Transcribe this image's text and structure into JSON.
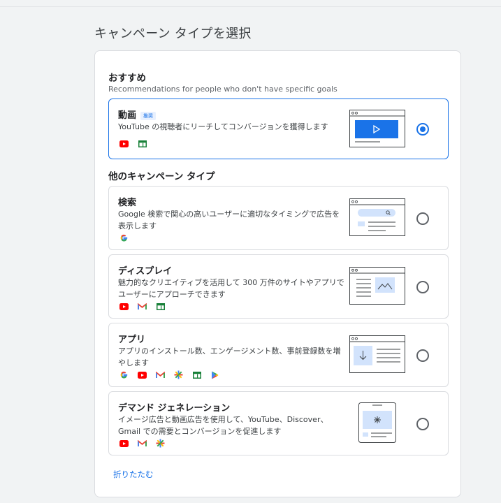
{
  "page": {
    "title": "キャンペーン タイプを選択"
  },
  "recommended": {
    "heading": "おすすめ",
    "subheading": "Recommendations for people who don't have specific goals"
  },
  "others": {
    "heading": "他のキャンペーン タイプ"
  },
  "cards": [
    {
      "title": "動画",
      "badge": "推奨",
      "description": "YouTube の視聴者にリーチしてコンバージョンを獲得します",
      "selected": true,
      "icons": [
        "youtube-icon",
        "display-icon"
      ]
    },
    {
      "title": "検索",
      "description": "Google 検索で関心の高いユーザーに適切なタイミングで広告を表示します",
      "selected": false,
      "icons": [
        "google-icon"
      ]
    },
    {
      "title": "ディスプレイ",
      "description": "魅力的なクリエイティブを活用して 300 万件のサイトやアプリでユーザーにアプローチできます",
      "selected": false,
      "icons": [
        "youtube-icon",
        "gmail-icon",
        "display-icon"
      ]
    },
    {
      "title": "アプリ",
      "description": "アプリのインストール数、エンゲージメント数、事前登録数を増やします",
      "selected": false,
      "icons": [
        "google-icon",
        "youtube-icon",
        "gmail-icon",
        "discover-icon",
        "display-icon",
        "google-play-icon"
      ]
    },
    {
      "title": "デマンド ジェネレーション",
      "description": "イメージ広告と動画広告を使用して、YouTube、Discover、Gmail での需要とコンバージョンを促進します",
      "selected": false,
      "icons": [
        "youtube-icon",
        "gmail-icon",
        "discover-icon"
      ]
    }
  ],
  "collapse": {
    "label": "折りたたむ"
  },
  "colors": {
    "accent": "#1a73e8",
    "youtube": "#ff0000",
    "display_green": "#188038",
    "illus_blue": "#1a73e8",
    "illus_light": "#d2e3fc"
  }
}
